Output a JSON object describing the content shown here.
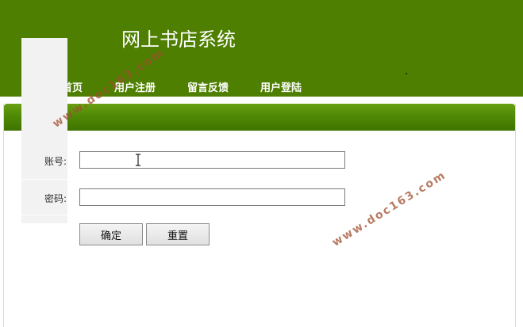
{
  "header": {
    "title": "网上书店系统",
    "nav": [
      "网站首页",
      "用户注册",
      "留言反馈",
      "用户登陆"
    ]
  },
  "form": {
    "account_label": "账号:",
    "account_value": "",
    "password_label": "密码:",
    "password_value": "",
    "confirm_button": "确定",
    "reset_button": "重置"
  },
  "watermark": {
    "text": "www.doc163.com"
  },
  "colors": {
    "header_bg": "#4e7f00",
    "panel_bar": "#4f8a06"
  }
}
